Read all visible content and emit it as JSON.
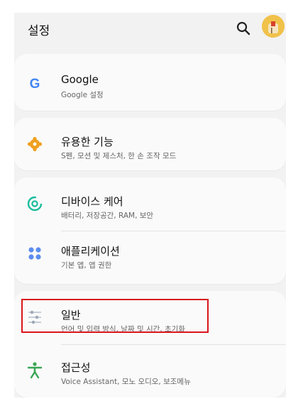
{
  "header": {
    "title": "설정",
    "search_icon": "search-icon",
    "avatar_icon": "user-avatar"
  },
  "colors": {
    "background": "#f2f2f2",
    "card": "#fafafa",
    "google_blue": "#4285f4",
    "advanced_orange": "#f0a020",
    "device_care_teal": "#1abc9c",
    "apps_blue": "#5b8def",
    "general_gray": "#9aa7b5",
    "accessibility_green": "#3aa655",
    "highlight_red": "#d9161c"
  },
  "items": [
    {
      "title": "Google",
      "subtitle": "Google 설정",
      "icon": "google-g-icon"
    },
    {
      "title": "유용한 기능",
      "subtitle": "S펜, 모션 및 제스처, 한 손 조작 모드",
      "icon": "puzzle-icon"
    },
    {
      "title": "디바이스 케어",
      "subtitle": "배터리, 저장공간, RAM, 보안",
      "icon": "device-care-icon"
    },
    {
      "title": "애플리케이션",
      "subtitle": "기본 앱, 앱 권한",
      "icon": "apps-grid-icon"
    },
    {
      "title": "일반",
      "subtitle": "언어 및 입력 방식, 날짜 및 시간, 초기화",
      "icon": "sliders-icon"
    },
    {
      "title": "접근성",
      "subtitle": "Voice Assistant, 모노 오디오, 보조메뉴",
      "icon": "accessibility-icon"
    }
  ]
}
